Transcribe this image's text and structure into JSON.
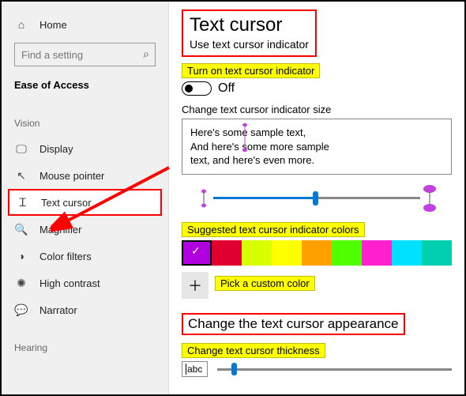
{
  "sidebar": {
    "home": "Home",
    "search_placeholder": "Find a setting",
    "ease": "Ease of Access",
    "vision": "Vision",
    "items": {
      "display": "Display",
      "mouse": "Mouse pointer",
      "textcursor": "Text cursor",
      "magnifier": "Magnifier",
      "colorfilters": "Color filters",
      "highcontrast": "High contrast",
      "narrator": "Narrator"
    },
    "hearing": "Hearing"
  },
  "main": {
    "title": "Text cursor",
    "subtitle": "Use text cursor indicator",
    "toggle_label": "Turn on text cursor indicator",
    "toggle_state": "Off",
    "size_label": "Change text cursor indicator size",
    "preview_l1": "Here's some sample text,",
    "preview_l2": "And here's some more sample",
    "preview_l3": "text, and here's even more.",
    "colors_label": "Suggested text cursor indicator colors",
    "swatches": [
      "#b000e0",
      "#e00030",
      "#d8ff00",
      "#ffff00",
      "#ffa000",
      "#50ff00",
      "#ff20d0",
      "#00e0ff",
      "#00d0b0"
    ],
    "custom_label": "Pick a custom color",
    "appearance_title": "Change the text cursor appearance",
    "thickness_label": "Change text cursor thickness",
    "thickness_preview": "abc"
  }
}
